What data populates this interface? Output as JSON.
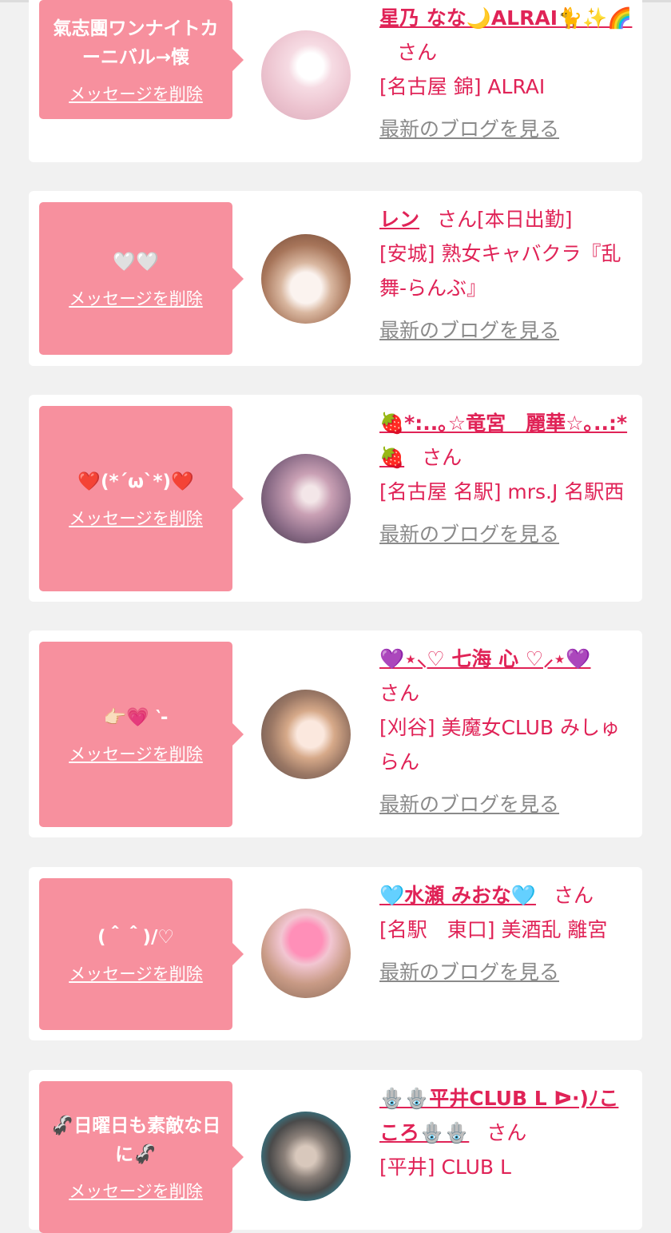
{
  "delete_label": "メッセージを削除",
  "blog_label": "最新のブログを見る",
  "san_label": "さん",
  "colors": {
    "bubble": "#f7909e",
    "accent": "#e02357",
    "link_gray": "#8a8a8a",
    "background": "#f1f1f1"
  },
  "cards": [
    {
      "message": "氣志團ワンナイトカーニバル→懐",
      "name": "星乃 なな🌙ALRAI🐈✨🌈",
      "extra": "",
      "shop": "[名古屋 錦] ALRAI",
      "avatar_icon": "avatar-photo"
    },
    {
      "message": "🤍🤍",
      "name": "レン",
      "extra": "[本日出勤]",
      "shop": "[安城] 熟女キャバクラ『乱舞-らんぶ』",
      "avatar_icon": "avatar-photo"
    },
    {
      "message": "❤️(*´ω`*)❤️",
      "name": "🍓*:..｡☆竜宮　麗華☆｡..:*🍓",
      "extra": "",
      "shop": "[名古屋 名駅] mrs.J 名駅西",
      "avatar_icon": "avatar-photo"
    },
    {
      "message": "👉🏻💗 ‵-",
      "name": "💜⋆⸜♡ 七海 心 ♡⸝⋆💜",
      "extra": "",
      "shop": "[刈谷] 美魔女CLUB みしゅらん",
      "avatar_icon": "avatar-photo"
    },
    {
      "message": "(＾＾)/♡",
      "name": "🩵水瀬 みおな🩵",
      "extra": "",
      "shop": "[名駅　東口] 美酒乱 離宮",
      "avatar_icon": "avatar-photo"
    },
    {
      "message": "🦨日曜日も素敵な日に🦨",
      "name": "🪬🪬平井CLUB L ᐅ·)ﾉこころ🪬🪬",
      "extra": "",
      "shop": "[平井] CLUB L",
      "avatar_icon": "avatar-photo"
    }
  ]
}
